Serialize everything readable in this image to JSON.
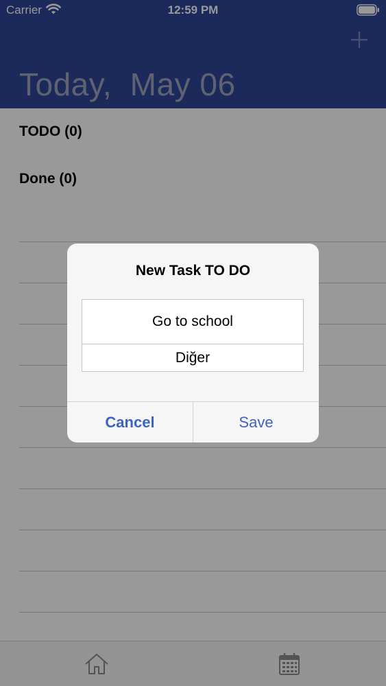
{
  "status_bar": {
    "carrier": "Carrier",
    "time": "12:59 PM",
    "wifi_icon": "wifi-icon",
    "battery_icon": "battery-icon"
  },
  "header": {
    "title": "Today,  May 06",
    "add_icon": "plus-icon",
    "background_color": "#2F4598"
  },
  "sections": {
    "todo": "TODO (0)",
    "done": "Done (0)"
  },
  "dialog": {
    "title": "New Task TO DO",
    "task_value": "Go to school",
    "category_value": "Diğer",
    "cancel_label": "Cancel",
    "save_label": "Save",
    "accent_color": "#3D63C8"
  },
  "tabbar": {
    "items": [
      {
        "icon": "home-icon"
      },
      {
        "icon": "calendar-icon"
      }
    ]
  }
}
